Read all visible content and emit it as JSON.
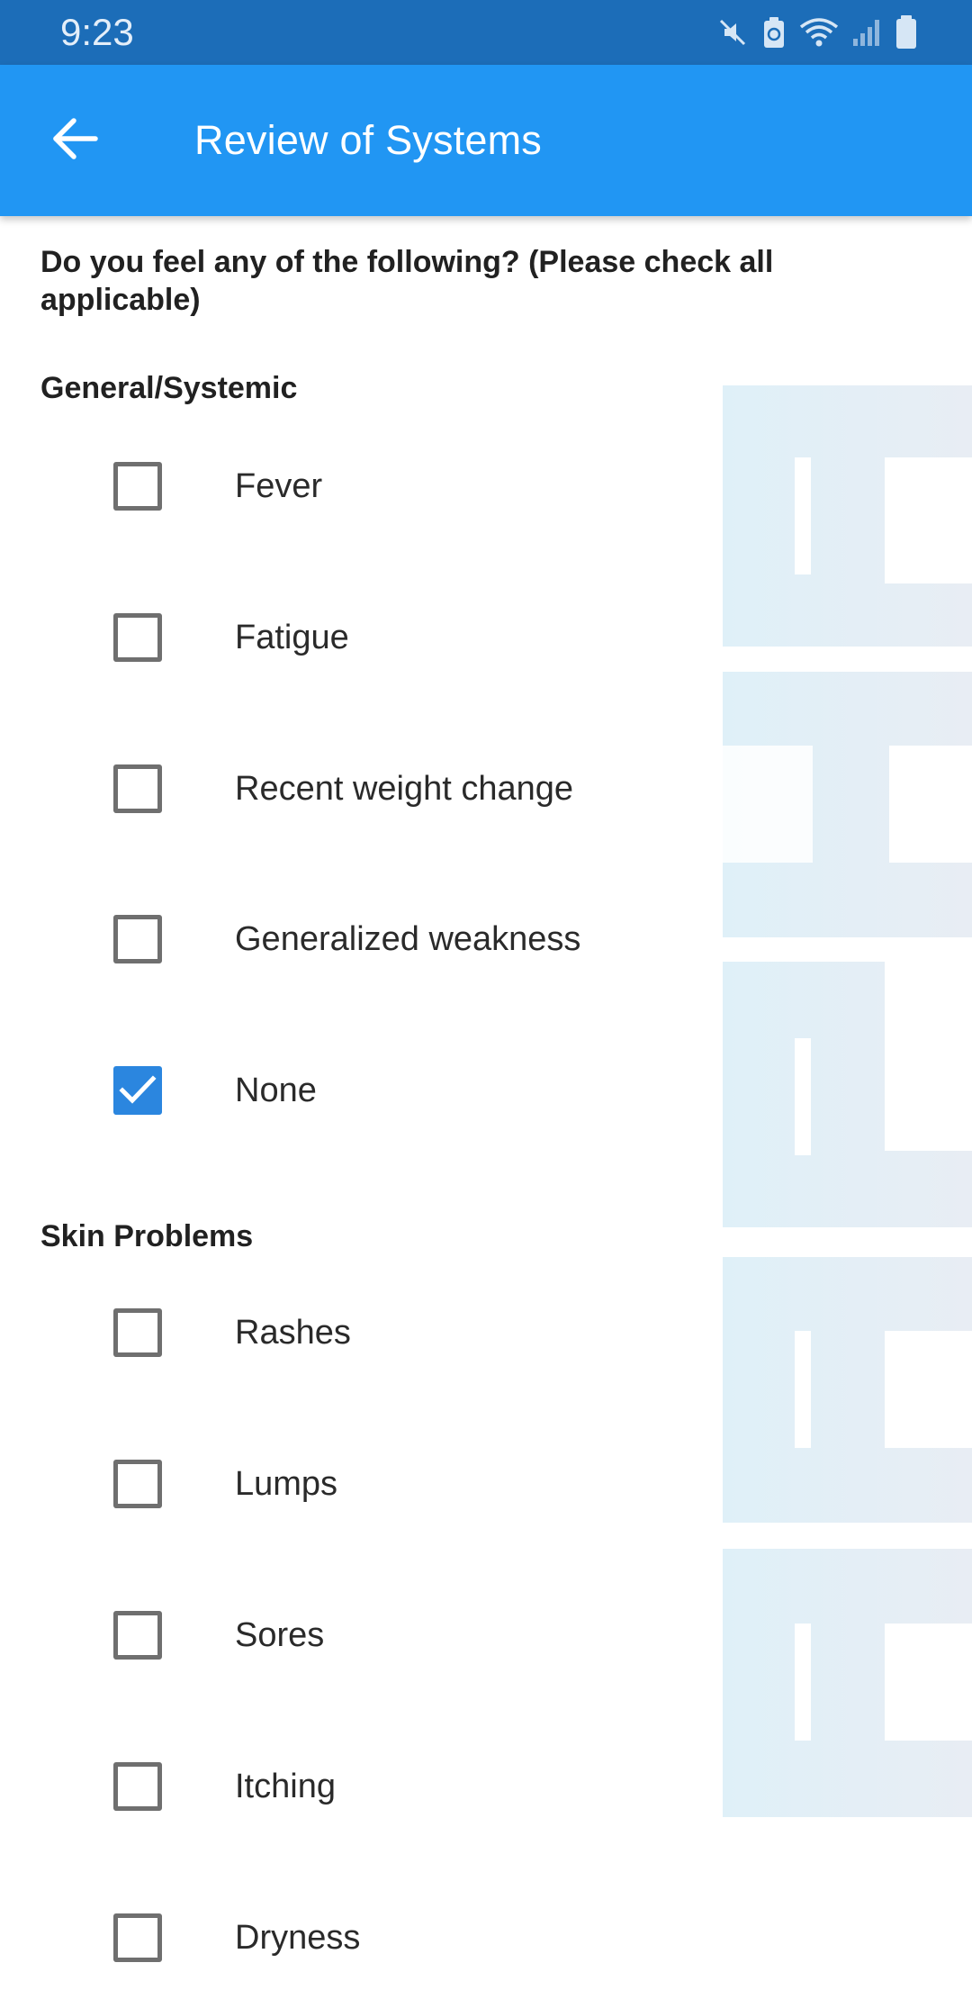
{
  "status_bar": {
    "time": "9:23",
    "icons": [
      "mute-icon",
      "battery-saver-icon",
      "wifi-icon",
      "cellular-signal-icon",
      "battery-icon"
    ]
  },
  "app_bar": {
    "title": "Review of Systems",
    "back_icon": "arrow-back-icon",
    "color": "#2196f3"
  },
  "question": "Do you feel any of the following? (Please check all applicable)",
  "sections": [
    {
      "title": "General/Systemic",
      "options": [
        {
          "label": "Fever",
          "checked": false
        },
        {
          "label": "Fatigue",
          "checked": false
        },
        {
          "label": "Recent weight change",
          "checked": false
        },
        {
          "label": "Generalized weakness",
          "checked": false
        },
        {
          "label": "None",
          "checked": true
        }
      ]
    },
    {
      "title": "Skin Problems",
      "options": [
        {
          "label": "Rashes",
          "checked": false
        },
        {
          "label": "Lumps",
          "checked": false
        },
        {
          "label": "Sores",
          "checked": false
        },
        {
          "label": "Itching",
          "checked": false
        },
        {
          "label": "Dryness",
          "checked": false
        }
      ]
    }
  ],
  "colors": {
    "status_bar": "#1c6db8",
    "checkbox_checked": "#2b86df",
    "checkbox_unchecked_border": "#6f6f6f"
  }
}
